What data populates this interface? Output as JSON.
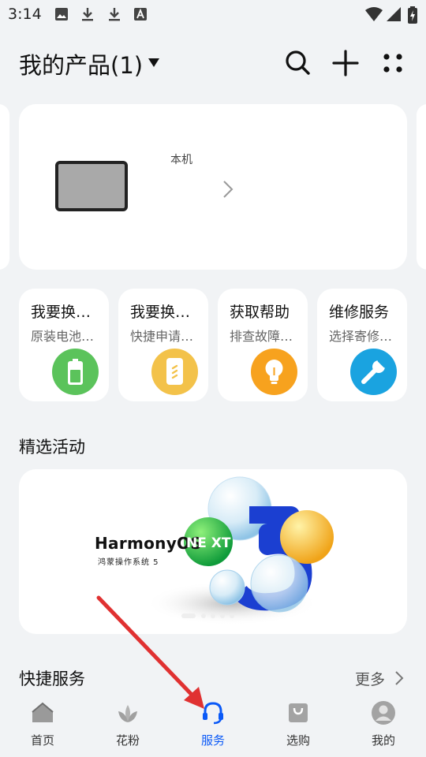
{
  "status_bar": {
    "time": "3:14",
    "icons": [
      "image-icon",
      "download-icon",
      "download-icon",
      "font-icon",
      "wifi-icon",
      "signal-icon",
      "battery-charging-icon"
    ]
  },
  "header": {
    "title": "我的产品(1)",
    "actions": [
      "search-icon",
      "add-icon",
      "more-icon"
    ]
  },
  "device_card": {
    "label": "本机"
  },
  "services": [
    {
      "title": "我要换…",
      "subtitle": "原装电池…",
      "icon": "battery-icon",
      "color": "#5bc35b"
    },
    {
      "title": "我要换…",
      "subtitle": "快捷申请…",
      "icon": "phone-replace-icon",
      "color": "#f3c24a"
    },
    {
      "title": "获取帮助",
      "subtitle": "排查故障…",
      "icon": "lightbulb-icon",
      "color": "#f7a21e"
    },
    {
      "title": "维修服务",
      "subtitle": "选择寄修…",
      "icon": "wrench-icon",
      "color": "#1aa3e0"
    }
  ],
  "featured": {
    "title": "精选活动",
    "banner_logo": "HarmonyOS",
    "banner_sub": "鸿蒙操作系统 5",
    "banner_badge": "NE XT",
    "banner_number": "5"
  },
  "quick_services": {
    "title": "快捷服务",
    "more": "更多"
  },
  "tabs": [
    {
      "label": "首页",
      "icon": "home-icon",
      "active": false
    },
    {
      "label": "花粉",
      "icon": "lotus-icon",
      "active": false
    },
    {
      "label": "服务",
      "icon": "headset-icon",
      "active": true
    },
    {
      "label": "选购",
      "icon": "shopping-bag-icon",
      "active": false
    },
    {
      "label": "我的",
      "icon": "profile-icon",
      "active": false
    }
  ],
  "colors": {
    "accent": "#0a59f7",
    "annotation_arrow": "#e03131"
  }
}
